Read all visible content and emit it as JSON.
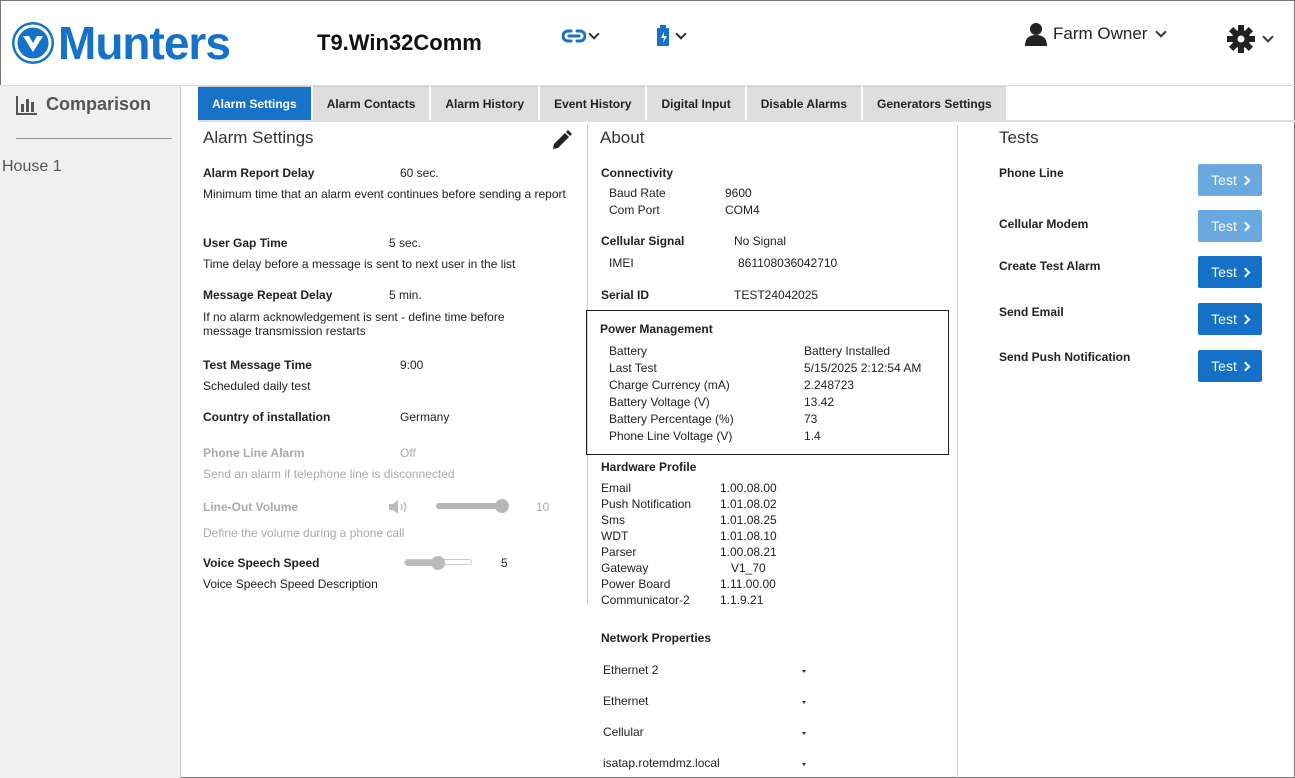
{
  "header": {
    "brand": "Munters",
    "app_title": "T9.Win32Comm",
    "user_name": "Farm Owner"
  },
  "sidebar": {
    "comparison": "Comparison",
    "house": "House 1"
  },
  "tabs": [
    {
      "label": "Alarm Settings",
      "active": true
    },
    {
      "label": "Alarm Contacts"
    },
    {
      "label": "Alarm History"
    },
    {
      "label": "Event History"
    },
    {
      "label": "Digital Input"
    },
    {
      "label": "Disable Alarms"
    },
    {
      "label": "Generators Settings"
    }
  ],
  "alarm_settings": {
    "title": "Alarm Settings",
    "report_delay": {
      "label": "Alarm Report Delay",
      "value": "60 sec.",
      "desc": "Minimum time that an alarm event continues before sending a report"
    },
    "user_gap": {
      "label": "User Gap Time",
      "value": "5 sec.",
      "desc": "Time delay before a message is sent to next user in the list"
    },
    "repeat_delay": {
      "label": "Message Repeat Delay",
      "value": "5 min.",
      "desc": "If no alarm acknowledgement is sent - define time before message transmission restarts"
    },
    "test_time": {
      "label": "Test Message Time",
      "value": "9:00",
      "desc": "Scheduled daily test"
    },
    "country": {
      "label": "Country of installation",
      "value": "Germany"
    },
    "phone_alarm": {
      "label": "Phone Line Alarm",
      "value": "Off",
      "desc": "Send an alarm if telephone line is disconnected"
    },
    "line_out": {
      "label": "Line-Out Volume",
      "value": "10",
      "desc": "Define the volume during a phone call",
      "level": 1.0
    },
    "voice_speed": {
      "label": "Voice Speech Speed",
      "value": "5",
      "desc": "Voice Speech Speed Description",
      "level": 0.5
    }
  },
  "about": {
    "title": "About",
    "connectivity": {
      "title": "Connectivity",
      "baud_label": "Baud Rate",
      "baud": "9600",
      "port_label": "Com Port",
      "port": "COM4"
    },
    "cellular": {
      "title": "Cellular Signal",
      "signal": "No Signal",
      "imei_label": "IMEI",
      "imei": "861108036042710"
    },
    "serial": {
      "label": "Serial ID",
      "value": "TEST24042025"
    },
    "power": {
      "title": "Power Management",
      "rows": [
        {
          "label": "Battery",
          "value": "Battery Installed"
        },
        {
          "label": "Last Test",
          "value": "5/15/2025 2:12:54 AM"
        },
        {
          "label": "Charge Currency (mA)",
          "value": "2.248723"
        },
        {
          "label": "Battery Voltage (V)",
          "value": "13.42"
        },
        {
          "label": "Battery Percentage (%)",
          "value": "73"
        },
        {
          "label": "Phone Line Voltage (V)",
          "value": "1.4"
        }
      ]
    },
    "hardware": {
      "title": "Hardware Profile",
      "rows": [
        {
          "label": "Email",
          "value": "1.00.08.00"
        },
        {
          "label": "Push Notification",
          "value": "1.01.08.02"
        },
        {
          "label": "Sms",
          "value": "1.01.08.25"
        },
        {
          "label": "WDT",
          "value": "1.01.08.10"
        },
        {
          "label": "Parser",
          "value": "1.00.08.21"
        },
        {
          "label": "Gateway",
          "value": "V1_70"
        },
        {
          "label": "Power Board",
          "value": "1.11.00.00"
        },
        {
          "label": "Communicator-2",
          "value": "1.1.9.21"
        }
      ]
    },
    "network": {
      "title": "Network Properties",
      "items": [
        "Ethernet 2",
        "Ethernet",
        "Cellular",
        "isatap.rotemdmz.local"
      ]
    }
  },
  "tests": {
    "title": "Tests",
    "button_label": "Test",
    "items": [
      {
        "label": "Phone Line",
        "enabled": false
      },
      {
        "label": "Cellular Modem",
        "enabled": false
      },
      {
        "label": "Create Test Alarm",
        "enabled": true
      },
      {
        "label": "Send Email",
        "enabled": true
      },
      {
        "label": "Send Push Notification",
        "enabled": true
      }
    ]
  },
  "colors": {
    "brand_blue": "#1572c8",
    "tab_active": "#1772c9",
    "button": "#1571c8",
    "button_disabled": "#6aa9df"
  }
}
